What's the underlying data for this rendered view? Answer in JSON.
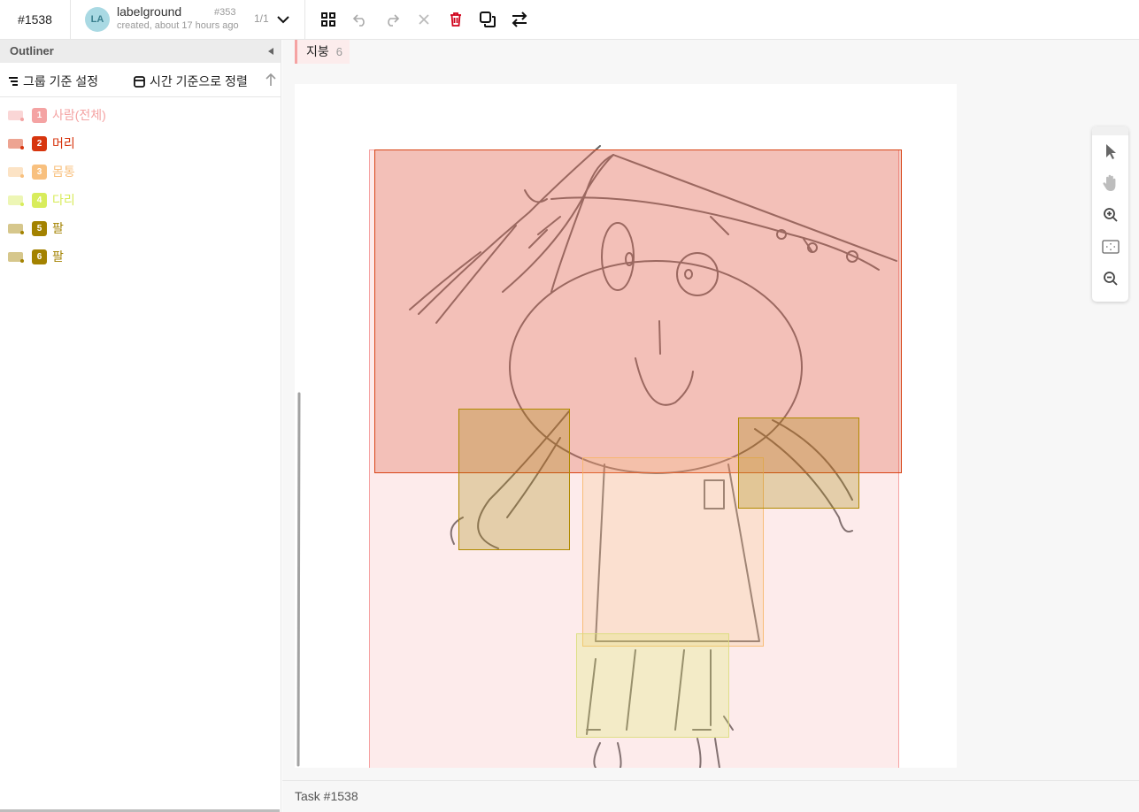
{
  "header": {
    "task_id": "#1538",
    "annotation": {
      "avatar_initials": "LA",
      "user": "labelground",
      "created": "created, about 17 hours ago",
      "number": "#353",
      "count": "1/1"
    },
    "tools": [
      "grid-view-icon",
      "undo-icon",
      "redo-icon",
      "clear-icon",
      "delete-icon",
      "copy-icon",
      "swap-icon"
    ]
  },
  "outliner": {
    "title": "Outliner",
    "group_by_label": "그룹 기준 설정",
    "order_label": "시간 기준으로 정렬",
    "regions": [
      {
        "index": "1",
        "label": "사람(전체)",
        "color": "#f4a3a3"
      },
      {
        "index": "2",
        "label": "머리",
        "color": "#d7350e"
      },
      {
        "index": "3",
        "label": "몸통",
        "color": "#f8c07e"
      },
      {
        "index": "4",
        "label": "다리",
        "color": "#d8ec5b"
      },
      {
        "index": "5",
        "label": "팔",
        "color": "#a38200"
      },
      {
        "index": "6",
        "label": "팔",
        "color": "#a38200"
      }
    ]
  },
  "canvas": {
    "label_chip": {
      "name": "지붕",
      "count": "6"
    }
  },
  "zoom_tools": [
    "pointer-icon",
    "hand-icon",
    "zoom-in-icon",
    "fit-icon",
    "zoom-out-icon"
  ],
  "status": {
    "text": "Task #1538"
  }
}
